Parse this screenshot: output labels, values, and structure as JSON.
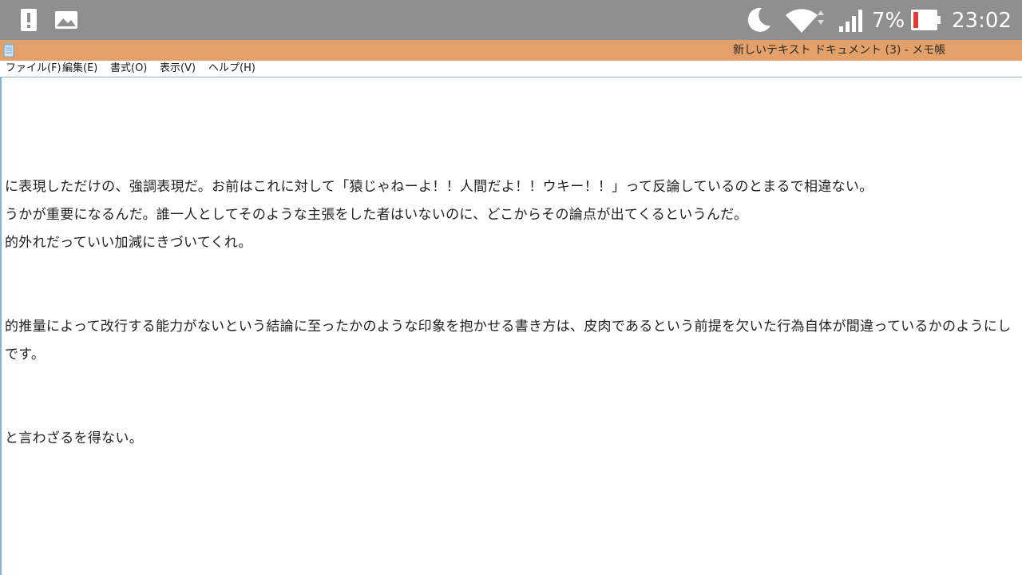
{
  "status_bar": {
    "battery_percent": "7%",
    "time": "23:02",
    "icons": [
      "alert-icon",
      "gallery-icon",
      "moon-icon",
      "wifi-icon",
      "signal-icon",
      "battery-icon"
    ],
    "colors": {
      "background": "#8f8f8f",
      "battery_low": "#e53935"
    }
  },
  "window": {
    "title": "新しいテキスト ドキュメント (3) - メモ帳",
    "app_icon": "notepad-icon",
    "titlebar_color": "#e3a068"
  },
  "menu": {
    "items": [
      "ファイル(F)",
      "編集(E)",
      "書式(O)",
      "表示(V)",
      "ヘルプ(H)"
    ]
  },
  "editor": {
    "lines": [
      "に表現しただけの、強調表現だ。お前はこれに対して「猿じゃねーよ！！人間だよ！！ウキー！！」って反論しているのとまるで相違ない。",
      "うかが重要になるんだ。誰一人としてそのような主張をした者はいないのに、どこからその論点が出てくるというんだ。",
      "的外れだっていい加減にきづいてくれ。",
      "的推量によって改行する能力がないという結論に至ったかのような印象を抱かせる書き方は、皮肉であるという前提を欠いた行為自体が間違っているかのようにし",
      "です。",
      "と言わざるを得ない。"
    ]
  }
}
